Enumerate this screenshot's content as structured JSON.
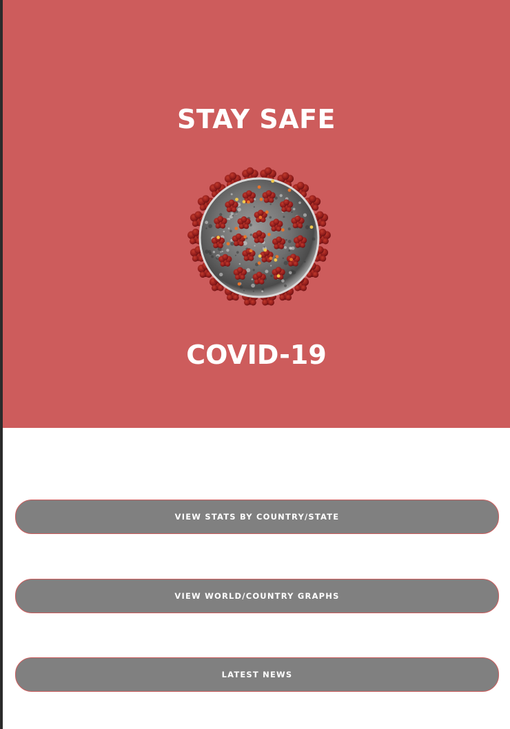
{
  "hero": {
    "title": "STAY SAFE",
    "subtitle": "COVID-19",
    "image_icon": "coronavirus-icon",
    "background_color": "#cd5c5c"
  },
  "nav": {
    "buttons": [
      {
        "label": "VIEW STATS BY COUNTRY/STATE"
      },
      {
        "label": "VIEW WORLD/COUNTRY GRAPHS"
      },
      {
        "label": "LATEST NEWS"
      }
    ],
    "button_color": "#808080",
    "button_border_color": "#cd5c5c"
  }
}
